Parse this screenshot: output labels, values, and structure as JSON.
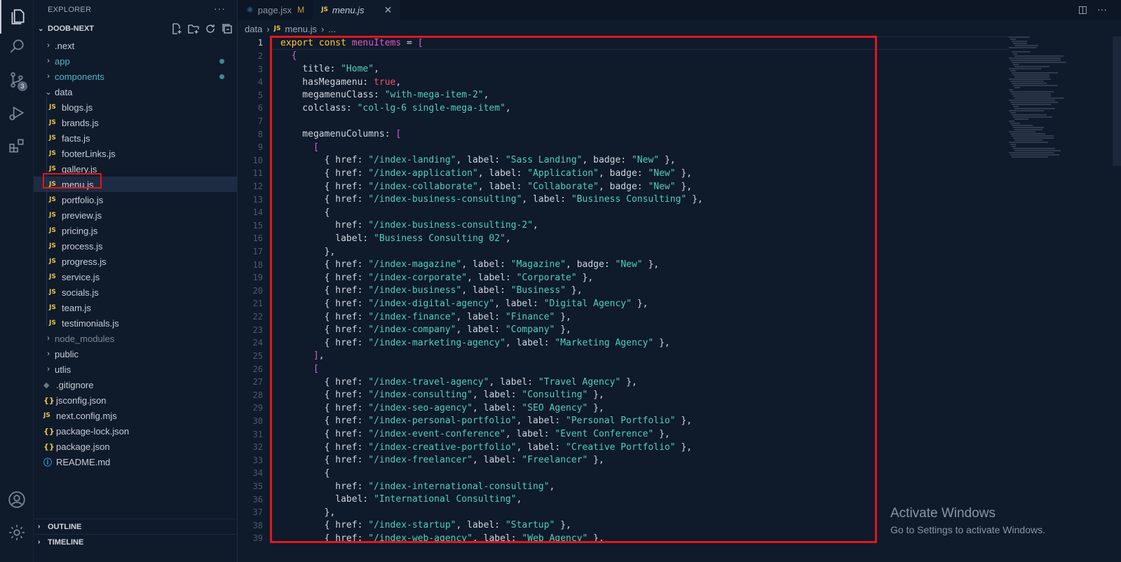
{
  "explorer": {
    "title": "EXPLORER",
    "more": "···",
    "project": "DOOB-NEXT",
    "tree": [
      {
        "label": ".next",
        "kind": "folder",
        "style": "normal"
      },
      {
        "label": "app",
        "kind": "folder",
        "style": "teal"
      },
      {
        "label": "components",
        "kind": "folder",
        "style": "teal"
      },
      {
        "label": "data",
        "kind": "folder-open",
        "style": "normal"
      },
      {
        "label": "blogs.js",
        "kind": "js"
      },
      {
        "label": "brands.js",
        "kind": "js"
      },
      {
        "label": "facts.js",
        "kind": "js"
      },
      {
        "label": "footerLinks.js",
        "kind": "js"
      },
      {
        "label": "gallery.js",
        "kind": "js"
      },
      {
        "label": "menu.js",
        "kind": "js"
      },
      {
        "label": "portfolio.js",
        "kind": "js"
      },
      {
        "label": "preview.js",
        "kind": "js"
      },
      {
        "label": "pricing.js",
        "kind": "js"
      },
      {
        "label": "process.js",
        "kind": "js"
      },
      {
        "label": "progress.js",
        "kind": "js"
      },
      {
        "label": "service.js",
        "kind": "js"
      },
      {
        "label": "socials.js",
        "kind": "js"
      },
      {
        "label": "team.js",
        "kind": "js"
      },
      {
        "label": "testimonials.js",
        "kind": "js"
      },
      {
        "label": "node_modules",
        "kind": "folder",
        "style": "dim"
      },
      {
        "label": "public",
        "kind": "folder",
        "style": "normal"
      },
      {
        "label": "utlis",
        "kind": "folder",
        "style": "normal"
      },
      {
        "label": ".gitignore",
        "kind": "git"
      },
      {
        "label": "jsconfig.json",
        "kind": "json"
      },
      {
        "label": "next.config.mjs",
        "kind": "js"
      },
      {
        "label": "package-lock.json",
        "kind": "json"
      },
      {
        "label": "package.json",
        "kind": "json"
      },
      {
        "label": "README.md",
        "kind": "info"
      }
    ],
    "outline": "OUTLINE",
    "timeline": "TIMELINE",
    "badge_count": "3"
  },
  "tabs": [
    {
      "label": "page.jsx",
      "icon": "jsx-icon",
      "status": "M"
    },
    {
      "label": "menu.js",
      "icon": "js-icon",
      "active": true
    }
  ],
  "breadcrumb": {
    "folder": "data",
    "file": "menu.js",
    "more": "..."
  },
  "icons": {
    "js": "JS",
    "json": "{}",
    "info": "ⓘ",
    "git": "◆"
  },
  "code_lines": [
    "export const menuItems = [",
    "  {",
    "    title: \"Home\",",
    "    hasMegamenu: true,",
    "    megamenuClass: \"with-mega-item-2\",",
    "    colclass: \"col-lg-6 single-mega-item\",",
    "",
    "    megamenuColumns: [",
    "      [",
    "        { href: \"/index-landing\", label: \"Sass Landing\", badge: \"New\" },",
    "        { href: \"/index-application\", label: \"Application\", badge: \"New\" },",
    "        { href: \"/index-collaborate\", label: \"Collaborate\", badge: \"New\" },",
    "        { href: \"/index-business-consulting\", label: \"Business Consulting\" },",
    "        {",
    "          href: \"/index-business-consulting-2\",",
    "          label: \"Business Consulting 02\",",
    "        },",
    "        { href: \"/index-magazine\", label: \"Magazine\", badge: \"New\" },",
    "        { href: \"/index-corporate\", label: \"Corporate\" },",
    "        { href: \"/index-business\", label: \"Business\" },",
    "        { href: \"/index-digital-agency\", label: \"Digital Agency\" },",
    "        { href: \"/index-finance\", label: \"Finance\" },",
    "        { href: \"/index-company\", label: \"Company\" },",
    "        { href: \"/index-marketing-agency\", label: \"Marketing Agency\" },",
    "      ],",
    "      [",
    "        { href: \"/index-travel-agency\", label: \"Travel Agency\" },",
    "        { href: \"/index-consulting\", label: \"Consulting\" },",
    "        { href: \"/index-seo-agency\", label: \"SEO Agency\" },",
    "        { href: \"/index-personal-portfolio\", label: \"Personal Portfolio\" },",
    "        { href: \"/index-event-conference\", label: \"Event Conference\" },",
    "        { href: \"/index-creative-portfolio\", label: \"Creative Portfolio\" },",
    "        { href: \"/index-freelancer\", label: \"Freelancer\" },",
    "        {",
    "          href: \"/index-international-consulting\",",
    "          label: \"International Consulting\",",
    "        },",
    "        { href: \"/index-startup\", label: \"Startup\" },",
    "        { href: \"/index-web-agency\", label: \"Web Agency\" },"
  ],
  "watermark": {
    "title": "Activate Windows",
    "subtitle": "Go to Settings to activate Windows."
  },
  "colors": {
    "background": "#0f1a2b",
    "keyword": "#ffca2e",
    "string": "#4fd1b9",
    "boolean": "#f0556a",
    "highlight_box": "#e2161c"
  }
}
